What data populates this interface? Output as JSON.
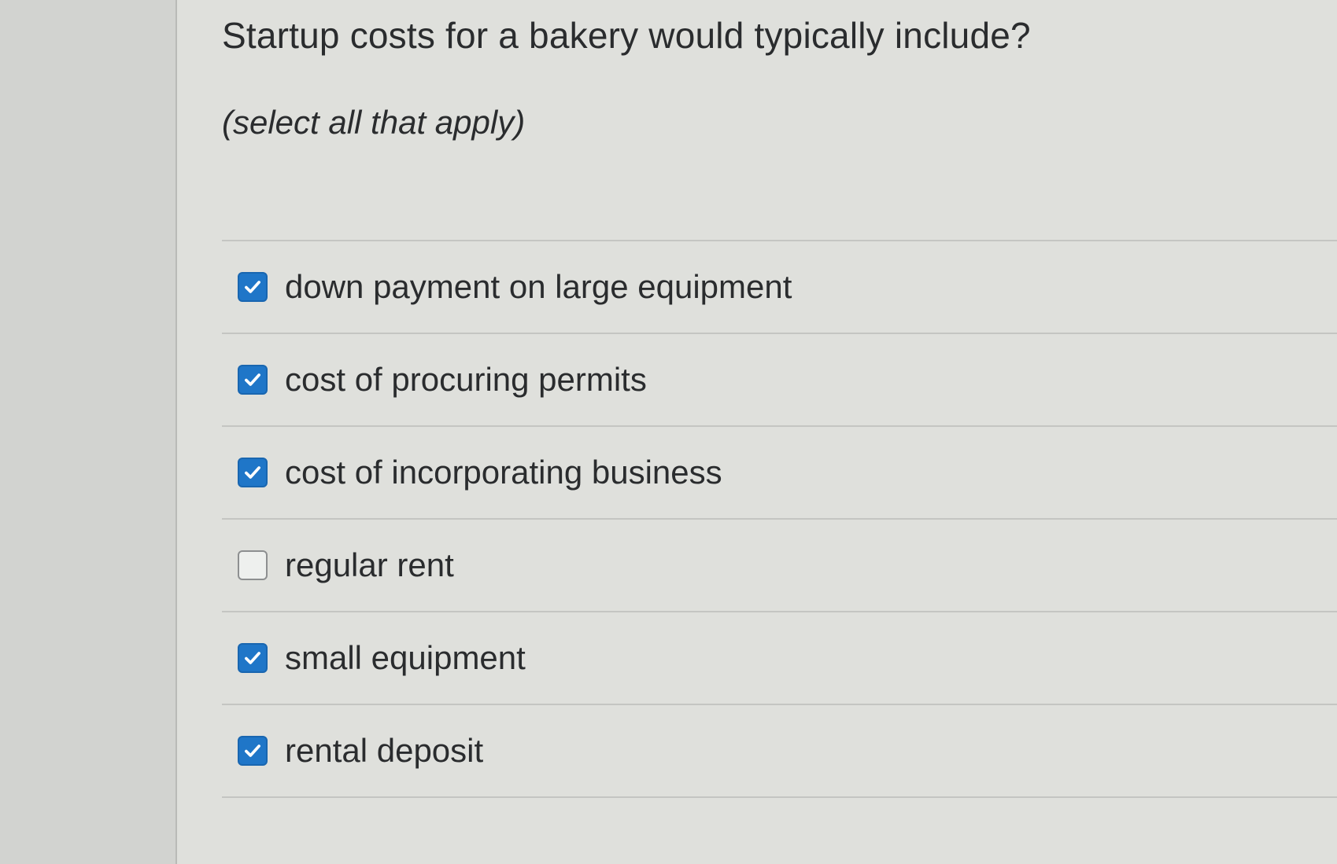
{
  "question": {
    "title": "Startup costs for a bakery would typically include?",
    "instruction": "(select all that apply)"
  },
  "options": [
    {
      "label": "down payment on large equipment",
      "checked": true
    },
    {
      "label": "cost of procuring permits",
      "checked": true
    },
    {
      "label": "cost of incorporating business",
      "checked": true
    },
    {
      "label": "regular rent",
      "checked": false
    },
    {
      "label": "small equipment",
      "checked": true
    },
    {
      "label": "rental deposit",
      "checked": true
    }
  ],
  "colors": {
    "checkbox_checked": "#1f76c8",
    "checkbox_unchecked_border": "#8d8f90",
    "panel_background": "#dfe0dc",
    "text": "#2a2c2e"
  },
  "icons": {
    "checked": "checkmark-icon"
  }
}
